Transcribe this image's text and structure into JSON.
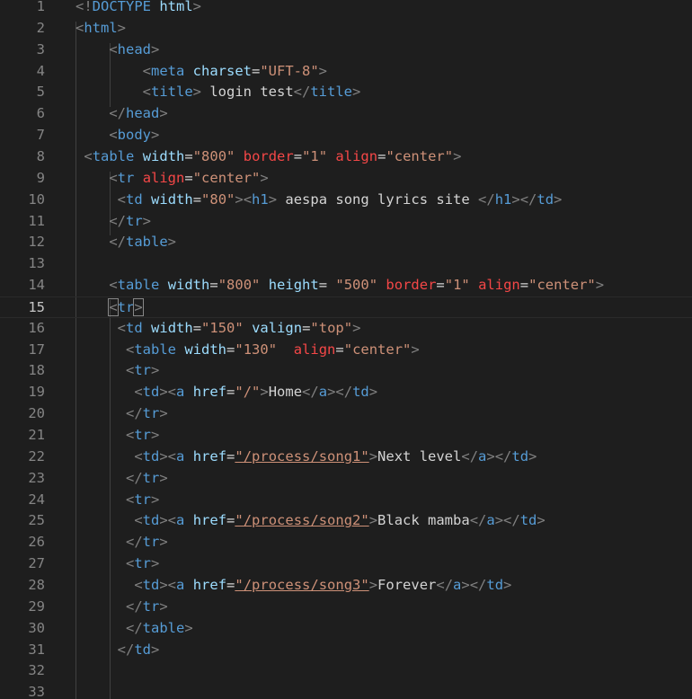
{
  "editor": {
    "lines": [
      {
        "n": "1",
        "indent": "",
        "tokens": [
          [
            "punc",
            "<!"
          ],
          [
            "tag",
            "DOCTYPE"
          ],
          [
            "text",
            " "
          ],
          [
            "attr",
            "html"
          ],
          [
            "punc",
            ">"
          ]
        ]
      },
      {
        "n": "2",
        "indent": "",
        "tokens": [
          [
            "punc",
            "<"
          ],
          [
            "tag",
            "html"
          ],
          [
            "punc",
            ">"
          ]
        ]
      },
      {
        "n": "3",
        "indent": "    ",
        "tokens": [
          [
            "punc",
            "<"
          ],
          [
            "tag",
            "head"
          ],
          [
            "punc",
            ">"
          ]
        ]
      },
      {
        "n": "4",
        "indent": "        ",
        "tokens": [
          [
            "punc",
            "<"
          ],
          [
            "tag",
            "meta"
          ],
          [
            "text",
            " "
          ],
          [
            "attr",
            "charset"
          ],
          [
            "text",
            "="
          ],
          [
            "str",
            "\"UFT-8\""
          ],
          [
            "punc",
            ">"
          ]
        ]
      },
      {
        "n": "5",
        "indent": "        ",
        "tokens": [
          [
            "punc",
            "<"
          ],
          [
            "tag",
            "title"
          ],
          [
            "punc",
            ">"
          ],
          [
            "text",
            " login test"
          ],
          [
            "punc",
            "</"
          ],
          [
            "tag",
            "title"
          ],
          [
            "punc",
            ">"
          ]
        ]
      },
      {
        "n": "6",
        "indent": "    ",
        "tokens": [
          [
            "punc",
            "</"
          ],
          [
            "tag",
            "head"
          ],
          [
            "punc",
            ">"
          ]
        ]
      },
      {
        "n": "7",
        "indent": "    ",
        "tokens": [
          [
            "punc",
            "<"
          ],
          [
            "tag",
            "body"
          ],
          [
            "punc",
            ">"
          ]
        ]
      },
      {
        "n": "8",
        "indent": " ",
        "tokens": [
          [
            "punc",
            "<"
          ],
          [
            "tag",
            "table"
          ],
          [
            "text",
            " "
          ],
          [
            "attr",
            "width"
          ],
          [
            "text",
            "="
          ],
          [
            "str",
            "\"800\""
          ],
          [
            "text",
            " "
          ],
          [
            "warn",
            "border"
          ],
          [
            "text",
            "="
          ],
          [
            "str",
            "\"1\""
          ],
          [
            "text",
            " "
          ],
          [
            "warn",
            "align"
          ],
          [
            "text",
            "="
          ],
          [
            "str",
            "\"center\""
          ],
          [
            "punc",
            ">"
          ]
        ]
      },
      {
        "n": "9",
        "indent": "    ",
        "tokens": [
          [
            "punc",
            "<"
          ],
          [
            "tag",
            "tr"
          ],
          [
            "text",
            " "
          ],
          [
            "warn",
            "align"
          ],
          [
            "text",
            "="
          ],
          [
            "str",
            "\"center\""
          ],
          [
            "punc",
            ">"
          ]
        ]
      },
      {
        "n": "10",
        "indent": "     ",
        "tokens": [
          [
            "punc",
            "<"
          ],
          [
            "tag",
            "td"
          ],
          [
            "text",
            " "
          ],
          [
            "attr",
            "width"
          ],
          [
            "text",
            "="
          ],
          [
            "str",
            "\"80\""
          ],
          [
            "punc",
            "><"
          ],
          [
            "tag",
            "h1"
          ],
          [
            "punc",
            ">"
          ],
          [
            "text",
            " aespa song lyrics site "
          ],
          [
            "punc",
            "</"
          ],
          [
            "tag",
            "h1"
          ],
          [
            "punc",
            "></"
          ],
          [
            "tag",
            "td"
          ],
          [
            "punc",
            ">"
          ]
        ]
      },
      {
        "n": "11",
        "indent": "    ",
        "tokens": [
          [
            "punc",
            "</"
          ],
          [
            "tag",
            "tr"
          ],
          [
            "punc",
            ">"
          ]
        ]
      },
      {
        "n": "12",
        "indent": "    ",
        "tokens": [
          [
            "punc",
            "</"
          ],
          [
            "tag",
            "table"
          ],
          [
            "punc",
            ">"
          ]
        ]
      },
      {
        "n": "13",
        "indent": "",
        "tokens": []
      },
      {
        "n": "14",
        "indent": "    ",
        "tokens": [
          [
            "punc",
            "<"
          ],
          [
            "tag",
            "table"
          ],
          [
            "text",
            " "
          ],
          [
            "attr",
            "width"
          ],
          [
            "text",
            "="
          ],
          [
            "str",
            "\"800\""
          ],
          [
            "text",
            " "
          ],
          [
            "attr",
            "height"
          ],
          [
            "text",
            "= "
          ],
          [
            "str",
            "\"500\""
          ],
          [
            "text",
            " "
          ],
          [
            "warn",
            "border"
          ],
          [
            "text",
            "="
          ],
          [
            "str",
            "\"1\""
          ],
          [
            "text",
            " "
          ],
          [
            "warn",
            "align"
          ],
          [
            "text",
            "="
          ],
          [
            "str",
            "\"center\""
          ],
          [
            "punc",
            ">"
          ]
        ]
      },
      {
        "n": "15",
        "indent": "    ",
        "tokens": [
          [
            "bracket",
            "<"
          ],
          [
            "tag",
            "tr"
          ],
          [
            "bracket",
            ">"
          ]
        ],
        "current": true
      },
      {
        "n": "16",
        "indent": "     ",
        "tokens": [
          [
            "punc",
            "<"
          ],
          [
            "tag",
            "td"
          ],
          [
            "text",
            " "
          ],
          [
            "attr",
            "width"
          ],
          [
            "text",
            "="
          ],
          [
            "str",
            "\"150\""
          ],
          [
            "text",
            " "
          ],
          [
            "attr",
            "valign"
          ],
          [
            "text",
            "="
          ],
          [
            "str",
            "\"top\""
          ],
          [
            "punc",
            ">"
          ]
        ]
      },
      {
        "n": "17",
        "indent": "      ",
        "tokens": [
          [
            "punc",
            "<"
          ],
          [
            "tag",
            "table"
          ],
          [
            "text",
            " "
          ],
          [
            "attr",
            "width"
          ],
          [
            "text",
            "="
          ],
          [
            "str",
            "\"130\""
          ],
          [
            "text",
            "  "
          ],
          [
            "warn",
            "align"
          ],
          [
            "text",
            "="
          ],
          [
            "str",
            "\"center\""
          ],
          [
            "punc",
            ">"
          ]
        ]
      },
      {
        "n": "18",
        "indent": "      ",
        "tokens": [
          [
            "punc",
            "<"
          ],
          [
            "tag",
            "tr"
          ],
          [
            "punc",
            ">"
          ]
        ]
      },
      {
        "n": "19",
        "indent": "       ",
        "tokens": [
          [
            "punc",
            "<"
          ],
          [
            "tag",
            "td"
          ],
          [
            "punc",
            "><"
          ],
          [
            "tag",
            "a"
          ],
          [
            "text",
            " "
          ],
          [
            "attr",
            "href"
          ],
          [
            "text",
            "="
          ],
          [
            "str",
            "\"/\""
          ],
          [
            "punc",
            ">"
          ],
          [
            "text",
            "Home"
          ],
          [
            "punc",
            "</"
          ],
          [
            "tag",
            "a"
          ],
          [
            "punc",
            "></"
          ],
          [
            "tag",
            "td"
          ],
          [
            "punc",
            ">"
          ]
        ]
      },
      {
        "n": "20",
        "indent": "      ",
        "tokens": [
          [
            "punc",
            "</"
          ],
          [
            "tag",
            "tr"
          ],
          [
            "punc",
            ">"
          ]
        ]
      },
      {
        "n": "21",
        "indent": "      ",
        "tokens": [
          [
            "punc",
            "<"
          ],
          [
            "tag",
            "tr"
          ],
          [
            "punc",
            ">"
          ]
        ]
      },
      {
        "n": "22",
        "indent": "       ",
        "tokens": [
          [
            "punc",
            "<"
          ],
          [
            "tag",
            "td"
          ],
          [
            "punc",
            "><"
          ],
          [
            "tag",
            "a"
          ],
          [
            "text",
            " "
          ],
          [
            "attr",
            "href"
          ],
          [
            "text",
            "="
          ],
          [
            "link",
            "\"/process/song1\""
          ],
          [
            "punc",
            ">"
          ],
          [
            "text",
            "Next level"
          ],
          [
            "punc",
            "</"
          ],
          [
            "tag",
            "a"
          ],
          [
            "punc",
            "></"
          ],
          [
            "tag",
            "td"
          ],
          [
            "punc",
            ">"
          ]
        ]
      },
      {
        "n": "23",
        "indent": "      ",
        "tokens": [
          [
            "punc",
            "</"
          ],
          [
            "tag",
            "tr"
          ],
          [
            "punc",
            ">"
          ]
        ]
      },
      {
        "n": "24",
        "indent": "      ",
        "tokens": [
          [
            "punc",
            "<"
          ],
          [
            "tag",
            "tr"
          ],
          [
            "punc",
            ">"
          ]
        ]
      },
      {
        "n": "25",
        "indent": "       ",
        "tokens": [
          [
            "punc",
            "<"
          ],
          [
            "tag",
            "td"
          ],
          [
            "punc",
            "><"
          ],
          [
            "tag",
            "a"
          ],
          [
            "text",
            " "
          ],
          [
            "attr",
            "href"
          ],
          [
            "text",
            "="
          ],
          [
            "link",
            "\"/process/song2\""
          ],
          [
            "punc",
            ">"
          ],
          [
            "text",
            "Black mamba"
          ],
          [
            "punc",
            "</"
          ],
          [
            "tag",
            "a"
          ],
          [
            "punc",
            "></"
          ],
          [
            "tag",
            "td"
          ],
          [
            "punc",
            ">"
          ]
        ]
      },
      {
        "n": "26",
        "indent": "      ",
        "tokens": [
          [
            "punc",
            "</"
          ],
          [
            "tag",
            "tr"
          ],
          [
            "punc",
            ">"
          ]
        ]
      },
      {
        "n": "27",
        "indent": "      ",
        "tokens": [
          [
            "punc",
            "<"
          ],
          [
            "tag",
            "tr"
          ],
          [
            "punc",
            ">"
          ]
        ]
      },
      {
        "n": "28",
        "indent": "       ",
        "tokens": [
          [
            "punc",
            "<"
          ],
          [
            "tag",
            "td"
          ],
          [
            "punc",
            "><"
          ],
          [
            "tag",
            "a"
          ],
          [
            "text",
            " "
          ],
          [
            "attr",
            "href"
          ],
          [
            "text",
            "="
          ],
          [
            "link",
            "\"/process/song3\""
          ],
          [
            "punc",
            ">"
          ],
          [
            "text",
            "Forever"
          ],
          [
            "punc",
            "</"
          ],
          [
            "tag",
            "a"
          ],
          [
            "punc",
            "></"
          ],
          [
            "tag",
            "td"
          ],
          [
            "punc",
            ">"
          ]
        ]
      },
      {
        "n": "29",
        "indent": "      ",
        "tokens": [
          [
            "punc",
            "</"
          ],
          [
            "tag",
            "tr"
          ],
          [
            "punc",
            ">"
          ]
        ]
      },
      {
        "n": "30",
        "indent": "      ",
        "tokens": [
          [
            "punc",
            "</"
          ],
          [
            "tag",
            "table"
          ],
          [
            "punc",
            ">"
          ]
        ]
      },
      {
        "n": "31",
        "indent": "     ",
        "tokens": [
          [
            "punc",
            "</"
          ],
          [
            "tag",
            "td"
          ],
          [
            "punc",
            ">"
          ]
        ]
      },
      {
        "n": "32",
        "indent": "",
        "tokens": []
      },
      {
        "n": "33",
        "indent": "",
        "tokens": []
      }
    ]
  },
  "colors": {
    "background": "#1e1e1e",
    "line_number": "#858585",
    "tag": "#569cd6",
    "attribute": "#9cdcfe",
    "attribute_warning": "#f44747",
    "string": "#ce9178",
    "text": "#d4d4d4",
    "punctuation": "#808080"
  }
}
